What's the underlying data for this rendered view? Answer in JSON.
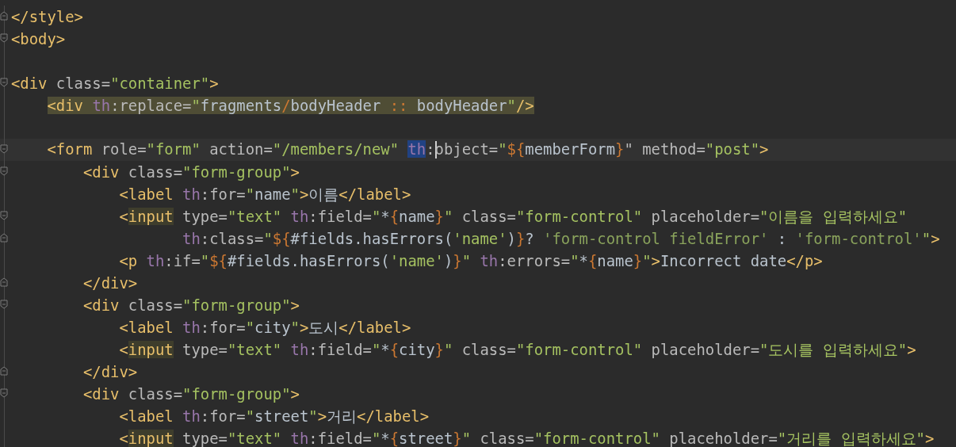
{
  "editor": {
    "lines": [
      {
        "kind": "normal",
        "fold_start": false,
        "fold_end": true,
        "tokens": [
          {
            "text": "</style>",
            "kind": "tag"
          }
        ]
      },
      {
        "kind": "normal",
        "fold_start": true,
        "fold_end": false,
        "tokens": [
          {
            "text": "<body>",
            "kind": "tag"
          }
        ]
      },
      {
        "kind": "normal",
        "fold_start": false,
        "fold_end": false
      },
      {
        "kind": "normal",
        "fold_start": true,
        "fold_end": false,
        "tokens": [
          {
            "text": "<div",
            "kind": "tag"
          },
          {
            "text": " class=",
            "kind": "attr"
          },
          {
            "text": "\"container\"",
            "kind": "str"
          },
          {
            "text": ">",
            "kind": "tag"
          }
        ]
      },
      {
        "kind": "usage",
        "fold_start": false,
        "fold_end": false,
        "tokens": [
          {
            "text": "    <div ",
            "kind": "tag"
          },
          {
            "text": "th",
            "kind": "ns"
          },
          {
            "text": ":replace=",
            "kind": "attr"
          },
          {
            "text": "\"",
            "kind": "str"
          },
          {
            "text": "fragments",
            "kind": "plain"
          },
          {
            "text": "/",
            "kind": "op"
          },
          {
            "text": "bodyHeader",
            "kind": "plain"
          },
          {
            "text": " :: ",
            "kind": "op"
          },
          {
            "text": "bodyHeader",
            "kind": "plain"
          },
          {
            "text": "\"",
            "kind": "str"
          },
          {
            "text": "/>",
            "kind": "tag"
          }
        ]
      },
      {
        "kind": "normal",
        "fold_start": false,
        "fold_end": false
      },
      {
        "kind": "current",
        "fold_start": true,
        "fold_end": false,
        "tokens": [
          {
            "text": "    <form",
            "kind": "tag"
          },
          {
            "text": " role=",
            "kind": "attr"
          },
          {
            "text": "\"form\"",
            "kind": "str"
          },
          {
            "text": " action=",
            "kind": "attr"
          },
          {
            "text": "\"/members/new\" ",
            "kind": "str"
          },
          {
            "text": "th",
            "kind": "ns-selected"
          },
          {
            "text": ":",
            "kind": "attr"
          },
          {
            "kind": "caret"
          },
          {
            "text": "object=",
            "kind": "attr"
          },
          {
            "text": "\"",
            "kind": "str"
          },
          {
            "text": "${",
            "kind": "op"
          },
          {
            "text": "memberForm",
            "kind": "plain"
          },
          {
            "text": "}",
            "kind": "op"
          },
          {
            "text": "\"",
            "kind": "attr"
          },
          {
            "text": " method=",
            "kind": "attr"
          },
          {
            "text": "\"post\"",
            "kind": "str"
          },
          {
            "text": ">",
            "kind": "tag"
          }
        ]
      },
      {
        "kind": "normal",
        "fold_start": true,
        "fold_end": false,
        "tokens": [
          {
            "text": "        <div",
            "kind": "tag"
          },
          {
            "text": " class=",
            "kind": "attr"
          },
          {
            "text": "\"form-group\"",
            "kind": "str"
          },
          {
            "text": ">",
            "kind": "tag"
          }
        ]
      },
      {
        "kind": "normal",
        "fold_start": false,
        "fold_end": false,
        "tokens": [
          {
            "text": "            <label ",
            "kind": "tag"
          },
          {
            "text": "th",
            "kind": "ns"
          },
          {
            "text": ":for=",
            "kind": "attr"
          },
          {
            "text": "\"",
            "kind": "str"
          },
          {
            "text": "name",
            "kind": "plain"
          },
          {
            "text": "\"",
            "kind": "str"
          },
          {
            "text": ">",
            "kind": "tag"
          },
          {
            "text": "이름",
            "kind": "plain"
          },
          {
            "text": "</label>",
            "kind": "tag"
          }
        ]
      },
      {
        "kind": "normal",
        "fold_start": true,
        "fold_end": false,
        "tokens": [
          {
            "text": "            <",
            "kind": "tag"
          },
          {
            "text": "input",
            "kind": "tag-matched"
          },
          {
            "text": " type=",
            "kind": "attr"
          },
          {
            "text": "\"text\" ",
            "kind": "str"
          },
          {
            "text": "th",
            "kind": "ns"
          },
          {
            "text": ":field=",
            "kind": "attr"
          },
          {
            "text": "\"",
            "kind": "str"
          },
          {
            "text": "*",
            "kind": "plain"
          },
          {
            "text": "{",
            "kind": "op"
          },
          {
            "text": "name",
            "kind": "plain"
          },
          {
            "text": "}",
            "kind": "op"
          },
          {
            "text": "\"",
            "kind": "str"
          },
          {
            "text": " class=",
            "kind": "attr"
          },
          {
            "text": "\"form-control\"",
            "kind": "str"
          },
          {
            "text": " placeholder=",
            "kind": "attr"
          },
          {
            "text": "\"이름을 입력하세요\"",
            "kind": "str"
          }
        ]
      },
      {
        "kind": "normal",
        "fold_start": false,
        "fold_end": true,
        "tokens": [
          {
            "text": "                   th",
            "kind": "ns"
          },
          {
            "text": ":class=",
            "kind": "attr"
          },
          {
            "text": "\"",
            "kind": "str"
          },
          {
            "text": "${",
            "kind": "op"
          },
          {
            "text": "#fields.hasErrors(",
            "kind": "plain"
          },
          {
            "text": "'name'",
            "kind": "str"
          },
          {
            "text": ")",
            "kind": "plain"
          },
          {
            "text": "}",
            "kind": "op"
          },
          {
            "text": "? ",
            "kind": "plain"
          },
          {
            "text": "'form-control fieldError'",
            "kind": "sq"
          },
          {
            "text": " : ",
            "kind": "plain"
          },
          {
            "text": "'form-control'",
            "kind": "sq"
          },
          {
            "text": "\"",
            "kind": "str"
          },
          {
            "text": ">",
            "kind": "tag"
          }
        ]
      },
      {
        "kind": "normal",
        "fold_start": false,
        "fold_end": false,
        "tokens": [
          {
            "text": "            <p ",
            "kind": "tag"
          },
          {
            "text": "th",
            "kind": "ns"
          },
          {
            "text": ":if=",
            "kind": "attr"
          },
          {
            "text": "\"",
            "kind": "str"
          },
          {
            "text": "${",
            "kind": "op"
          },
          {
            "text": "#fields.hasErrors(",
            "kind": "plain"
          },
          {
            "text": "'name'",
            "kind": "str"
          },
          {
            "text": ")",
            "kind": "plain"
          },
          {
            "text": "}",
            "kind": "op"
          },
          {
            "text": "\" ",
            "kind": "str"
          },
          {
            "text": "th",
            "kind": "ns"
          },
          {
            "text": ":errors=",
            "kind": "attr"
          },
          {
            "text": "\"",
            "kind": "str"
          },
          {
            "text": "*",
            "kind": "plain"
          },
          {
            "text": "{",
            "kind": "op"
          },
          {
            "text": "name",
            "kind": "plain"
          },
          {
            "text": "}",
            "kind": "op"
          },
          {
            "text": "\"",
            "kind": "str"
          },
          {
            "text": ">",
            "kind": "tag"
          },
          {
            "text": "Incorrect date",
            "kind": "plain"
          },
          {
            "text": "</p>",
            "kind": "tag"
          }
        ]
      },
      {
        "kind": "normal",
        "fold_start": false,
        "fold_end": true,
        "tokens": [
          {
            "text": "        </div>",
            "kind": "tag"
          }
        ]
      },
      {
        "kind": "normal",
        "fold_start": true,
        "fold_end": false,
        "tokens": [
          {
            "text": "        <div",
            "kind": "tag"
          },
          {
            "text": " class=",
            "kind": "attr"
          },
          {
            "text": "\"form-group\"",
            "kind": "str"
          },
          {
            "text": ">",
            "kind": "tag"
          }
        ]
      },
      {
        "kind": "normal",
        "fold_start": false,
        "fold_end": false,
        "tokens": [
          {
            "text": "            <label ",
            "kind": "tag"
          },
          {
            "text": "th",
            "kind": "ns"
          },
          {
            "text": ":for=",
            "kind": "attr"
          },
          {
            "text": "\"",
            "kind": "str"
          },
          {
            "text": "city",
            "kind": "plain"
          },
          {
            "text": "\"",
            "kind": "str"
          },
          {
            "text": ">",
            "kind": "tag"
          },
          {
            "text": "도시",
            "kind": "plain"
          },
          {
            "text": "</label>",
            "kind": "tag"
          }
        ]
      },
      {
        "kind": "normal",
        "fold_start": false,
        "fold_end": false,
        "tokens": [
          {
            "text": "            <",
            "kind": "tag"
          },
          {
            "text": "input",
            "kind": "tag-matched"
          },
          {
            "text": " type=",
            "kind": "attr"
          },
          {
            "text": "\"text\" ",
            "kind": "str"
          },
          {
            "text": "th",
            "kind": "ns"
          },
          {
            "text": ":field=",
            "kind": "attr"
          },
          {
            "text": "\"",
            "kind": "str"
          },
          {
            "text": "*",
            "kind": "plain"
          },
          {
            "text": "{",
            "kind": "op"
          },
          {
            "text": "city",
            "kind": "plain"
          },
          {
            "text": "}",
            "kind": "op"
          },
          {
            "text": "\"",
            "kind": "str"
          },
          {
            "text": " class=",
            "kind": "attr"
          },
          {
            "text": "\"form-control\"",
            "kind": "str"
          },
          {
            "text": " placeholder=",
            "kind": "attr"
          },
          {
            "text": "\"도시를 입력하세요\"",
            "kind": "str"
          },
          {
            "text": ">",
            "kind": "tag"
          }
        ]
      },
      {
        "kind": "normal",
        "fold_start": false,
        "fold_end": true,
        "tokens": [
          {
            "text": "        </div>",
            "kind": "tag"
          }
        ]
      },
      {
        "kind": "normal",
        "fold_start": true,
        "fold_end": false,
        "tokens": [
          {
            "text": "        <div",
            "kind": "tag"
          },
          {
            "text": " class=",
            "kind": "attr"
          },
          {
            "text": "\"form-group\"",
            "kind": "str"
          },
          {
            "text": ">",
            "kind": "tag"
          }
        ]
      },
      {
        "kind": "normal",
        "fold_start": false,
        "fold_end": false,
        "tokens": [
          {
            "text": "            <label ",
            "kind": "tag"
          },
          {
            "text": "th",
            "kind": "ns"
          },
          {
            "text": ":for=",
            "kind": "attr"
          },
          {
            "text": "\"",
            "kind": "str"
          },
          {
            "text": "street",
            "kind": "plain"
          },
          {
            "text": "\"",
            "kind": "str"
          },
          {
            "text": ">",
            "kind": "tag"
          },
          {
            "text": "거리",
            "kind": "plain"
          },
          {
            "text": "</label>",
            "kind": "tag"
          }
        ]
      },
      {
        "kind": "normal",
        "fold_start": false,
        "fold_end": false,
        "tokens": [
          {
            "text": "            <",
            "kind": "tag"
          },
          {
            "text": "input",
            "kind": "tag-matched"
          },
          {
            "text": " type=",
            "kind": "attr"
          },
          {
            "text": "\"text\" ",
            "kind": "str"
          },
          {
            "text": "th",
            "kind": "ns"
          },
          {
            "text": ":field=",
            "kind": "attr"
          },
          {
            "text": "\"",
            "kind": "str"
          },
          {
            "text": "*",
            "kind": "plain"
          },
          {
            "text": "{",
            "kind": "op"
          },
          {
            "text": "street",
            "kind": "plain"
          },
          {
            "text": "}",
            "kind": "op"
          },
          {
            "text": "\"",
            "kind": "str"
          },
          {
            "text": " class=",
            "kind": "attr"
          },
          {
            "text": "\"form-control\"",
            "kind": "str"
          },
          {
            "text": " placeholder=",
            "kind": "attr"
          },
          {
            "text": "\"거리를 입력하세요\"",
            "kind": "str"
          },
          {
            "text": ">",
            "kind": "tag"
          }
        ]
      }
    ]
  }
}
